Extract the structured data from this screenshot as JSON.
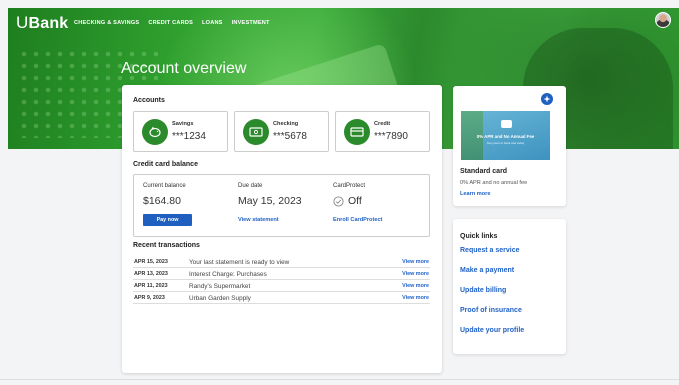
{
  "header": {
    "logo_mark": "U",
    "logo_text": "Bank",
    "nav": [
      "CHECKING & SAVINGS",
      "CREDIT CARDS",
      "LOANS",
      "INVESTMENT"
    ],
    "page_title": "Account overview"
  },
  "accounts": {
    "title": "Accounts",
    "items": [
      {
        "name": "Savings",
        "number": "***1234"
      },
      {
        "name": "Checking",
        "number": "***5678"
      },
      {
        "name": "Credit",
        "number": "***7890"
      }
    ]
  },
  "credit_card": {
    "title": "Credit card balance",
    "current_balance_label": "Current balance",
    "current_balance": "$164.80",
    "due_date_label": "Due date",
    "due_date": "May 15, 2023",
    "cardprotect_label": "CardProtect",
    "cardprotect_value": "Off",
    "pay_now": "Pay now",
    "view_statement": "View statement",
    "enroll": "Enroll CardProtect"
  },
  "transactions": {
    "title": "Recent transactions",
    "view_more": "View more",
    "rows": [
      {
        "date": "APR 15, 2023",
        "desc": "Your last statement is ready to view"
      },
      {
        "date": "APR 13, 2023",
        "desc": "Interest Charge: Purchases"
      },
      {
        "date": "APR 11, 2023",
        "desc": "Randy's Supermarket"
      },
      {
        "date": "APR 9, 2023",
        "desc": "Urban Garden Supply"
      }
    ]
  },
  "promo": {
    "banner_title": "0% APR and No Annual Fee",
    "banner_sub": "Get yours in bank and today",
    "title": "Standard card",
    "desc": "0% APR and no annual fee",
    "link": "Learn more"
  },
  "quick_links": {
    "title": "Quick links",
    "items": [
      "Request a service",
      "Make a payment",
      "Update billing",
      "Proof of insurance",
      "Update your profile"
    ]
  },
  "colors": {
    "brand_green": "#2b8a2b",
    "link_blue": "#2062c6",
    "button_blue": "#1f5fbf"
  }
}
